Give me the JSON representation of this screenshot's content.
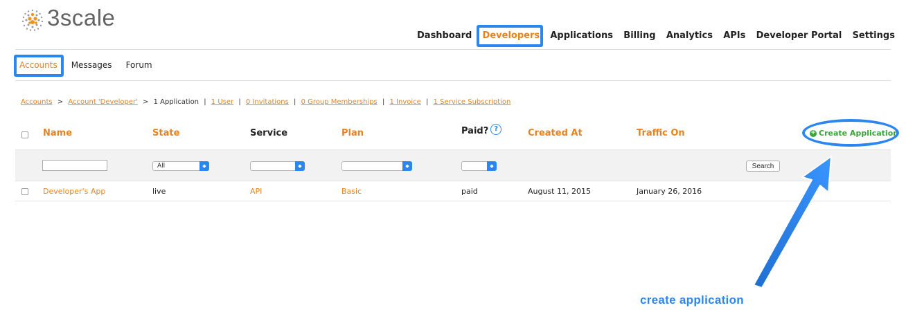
{
  "app": {
    "logo_text": "3scale"
  },
  "colors": {
    "accent": "#e8821e",
    "highlight": "#2b86ef",
    "create": "#3aa43a"
  },
  "topnav": {
    "items": [
      {
        "label": "Dashboard"
      },
      {
        "label": "Developers",
        "active": true
      },
      {
        "label": "Applications"
      },
      {
        "label": "Billing"
      },
      {
        "label": "Analytics"
      },
      {
        "label": "APIs"
      },
      {
        "label": "Developer Portal"
      },
      {
        "label": "Settings"
      }
    ]
  },
  "subnav": {
    "items": [
      {
        "label": "Accounts",
        "active": true
      },
      {
        "label": "Messages"
      },
      {
        "label": "Forum"
      }
    ]
  },
  "breadcrumb": {
    "accounts": "Accounts",
    "arrow": ">",
    "account": "Account 'Developer'",
    "current": "1 Application",
    "links": [
      "1 User",
      "0 Invitations",
      "0 Group Memberships",
      "1 Invoice",
      "1 Service Subscription"
    ]
  },
  "table": {
    "headers": {
      "name": "Name",
      "state": "State",
      "service": "Service",
      "plan": "Plan",
      "paid": "Paid?",
      "help": "?",
      "created_at": "Created At",
      "traffic_on": "Traffic On"
    },
    "create_label": "Create Application",
    "filters": {
      "name": "",
      "state": "All",
      "service": "",
      "plan": "",
      "paid": "",
      "search_label": "Search"
    },
    "rows": [
      {
        "name": "Developer's App",
        "state": "live",
        "service": "API",
        "plan": "Basic",
        "paid": "paid",
        "created_at": "August 11, 2015",
        "traffic_on": "January 26, 2016"
      }
    ]
  },
  "annotation": {
    "text": "create application"
  }
}
